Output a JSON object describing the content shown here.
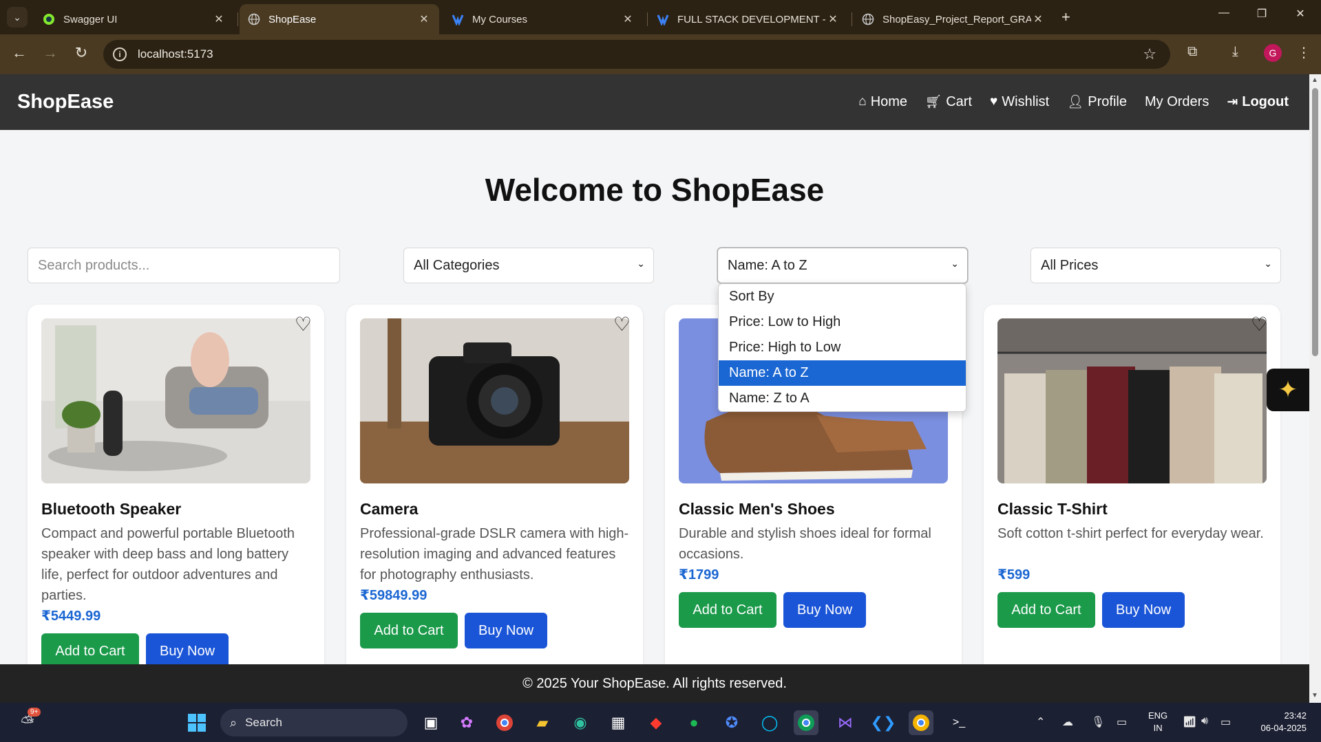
{
  "browser": {
    "tabs": [
      {
        "label": "Swagger UI",
        "icon": "swagger-icon",
        "color": "#85ea2d"
      },
      {
        "label": "ShopEase",
        "icon": "globe-icon",
        "color": "#cccccc"
      },
      {
        "label": "My Courses",
        "icon": "courses-icon",
        "color": "#3b82f6"
      },
      {
        "label": "FULL STACK DEVELOPMENT - C",
        "icon": "courses-icon",
        "color": "#3b82f6"
      },
      {
        "label": "ShopEasy_Project_Report_GRAC",
        "icon": "globe-icon",
        "color": "#cccccc"
      }
    ],
    "url": "localhost:5173",
    "profile_initial": "G"
  },
  "app": {
    "brand": "ShopEase",
    "nav": [
      {
        "label": "Home",
        "icon": "home-icon"
      },
      {
        "label": "Cart",
        "icon": "cart-icon"
      },
      {
        "label": "Wishlist",
        "icon": "heart-icon"
      },
      {
        "label": "Profile",
        "icon": "user-icon"
      },
      {
        "label": "My Orders",
        "icon": ""
      },
      {
        "label": "Logout",
        "icon": "logout-icon"
      }
    ],
    "title": "Welcome to ShopEase",
    "filters": {
      "search_placeholder": "Search products...",
      "category": "All Categories",
      "sort": "Name: A to Z",
      "price": "All Prices"
    },
    "sort_options": [
      "Sort By",
      "Price: Low to High",
      "Price: High to Low",
      "Name: A to Z",
      "Name: Z to A"
    ],
    "sort_selected_index": 3,
    "products": [
      {
        "name": "Bluetooth Speaker",
        "description": "Compact and powerful portable Bluetooth speaker with deep bass and long battery life, perfect for outdoor adventures and parties.",
        "price": "₹5449.99",
        "image": "speaker-photo"
      },
      {
        "name": "Camera",
        "description": "Professional-grade DSLR camera with high-resolution imaging and advanced features for photography enthusiasts.",
        "price": "₹59849.99",
        "image": "camera-photo"
      },
      {
        "name": "Classic Men's Shoes",
        "description": "Durable and stylish shoes ideal for formal occasions.",
        "price": "₹1799",
        "image": "shoes-photo"
      },
      {
        "name": "Classic T-Shirt",
        "description": "Soft cotton t-shirt perfect for everyday wear.",
        "price": "₹599",
        "image": "tshirt-photo"
      }
    ],
    "add_to_cart_label": "Add to Cart",
    "buy_now_label": "Buy Now",
    "footer": "© 2025 Your ShopEase. All rights reserved."
  },
  "taskbar": {
    "search_label": "Search",
    "weather_badge": "9+",
    "lang_line1": "ENG",
    "lang_line2": "IN",
    "time": "23:42",
    "date": "06-04-2025"
  },
  "colors": {
    "header_bg": "#333333",
    "price_blue": "#1a66d2",
    "add_to_cart_green": "#1b9a4a",
    "buy_now_blue": "#1a55d8",
    "dropdown_selected": "#1a66d2"
  }
}
